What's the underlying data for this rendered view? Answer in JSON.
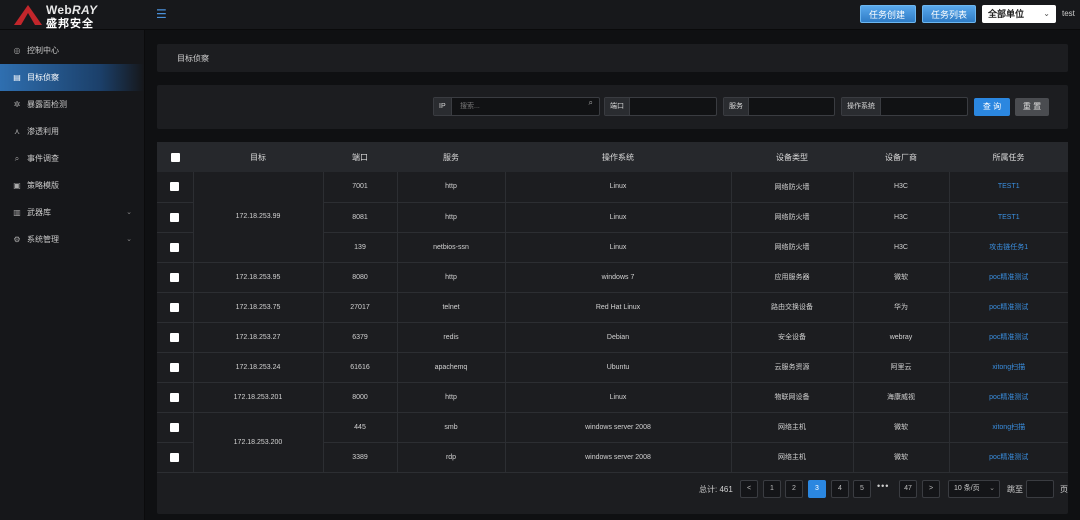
{
  "header": {
    "brand_web": "Web",
    "brand_ray": "RAY",
    "brand_cn": "盛邦安全",
    "btn_create": "任务创建",
    "btn_list": "任务列表",
    "unit_select": "全部单位",
    "user": "test"
  },
  "sidebar": {
    "items": [
      {
        "label": "控制中心"
      },
      {
        "label": "目标侦察"
      },
      {
        "label": "暴露面检测"
      },
      {
        "label": "渗透利用"
      },
      {
        "label": "事件调查"
      },
      {
        "label": "策略模版"
      },
      {
        "label": "武器库"
      },
      {
        "label": "系统管理"
      }
    ]
  },
  "breadcrumb": "目标侦察",
  "filters": {
    "ip_label": "IP",
    "ip_placeholder": "搜索...",
    "port_label": "端口",
    "service_label": "服务",
    "os_label": "操作系统",
    "query_btn": "查 询",
    "reset_btn": "重 置"
  },
  "table": {
    "columns": [
      "目标",
      "端口",
      "服务",
      "操作系统",
      "设备类型",
      "设备厂商",
      "所属任务"
    ],
    "rows": [
      {
        "target": "172.18.253.99",
        "port": "7001",
        "service": "http",
        "os": "Linux",
        "device_type": "网络防火墙",
        "vendor": "H3C",
        "task": "TEST1"
      },
      {
        "target": "",
        "port": "8081",
        "service": "http",
        "os": "Linux",
        "device_type": "网络防火墙",
        "vendor": "H3C",
        "task": "TEST1"
      },
      {
        "target": "",
        "port": "139",
        "service": "netbios-ssn",
        "os": "Linux",
        "device_type": "网络防火墙",
        "vendor": "H3C",
        "task": "攻击链任务1"
      },
      {
        "target": "172.18.253.95",
        "port": "8080",
        "service": "http",
        "os": "windows 7",
        "device_type": "应用服务器",
        "vendor": "微软",
        "task": "poc精准测试"
      },
      {
        "target": "172.18.253.75",
        "port": "27017",
        "service": "telnet",
        "os": "Red Hat Linux",
        "device_type": "路由交换设备",
        "vendor": "华为",
        "task": "poc精准测试"
      },
      {
        "target": "172.18.253.27",
        "port": "6379",
        "service": "redis",
        "os": "Debian",
        "device_type": "安全设备",
        "vendor": "webray",
        "task": "poc精准测试"
      },
      {
        "target": "172.18.253.24",
        "port": "61616",
        "service": "apachemq",
        "os": "Ubuntu",
        "device_type": "云服务资源",
        "vendor": "阿里云",
        "task": "xitong扫描"
      },
      {
        "target": "172.18.253.201",
        "port": "8000",
        "service": "http",
        "os": "Linux",
        "device_type": "物联网设备",
        "vendor": "海康威视",
        "task": "poc精准测试"
      },
      {
        "target": "172.18.253.200",
        "port": "445",
        "service": "smb",
        "os": "windows server 2008",
        "device_type": "网络主机",
        "vendor": "微软",
        "task": "xitong扫描"
      },
      {
        "target": "",
        "port": "3389",
        "service": "rdp",
        "os": "windows server 2008",
        "device_type": "网络主机",
        "vendor": "微软",
        "task": "poc精准测试"
      }
    ]
  },
  "pagination": {
    "total_label": "总计: 461",
    "pages": [
      "1",
      "2",
      "3",
      "4",
      "5"
    ],
    "current": "3",
    "last": "47",
    "dots": "•••",
    "prev": "<",
    "next": ">",
    "page_size": "10 条/页",
    "goto_label": "跳至",
    "page_suffix": "页"
  }
}
